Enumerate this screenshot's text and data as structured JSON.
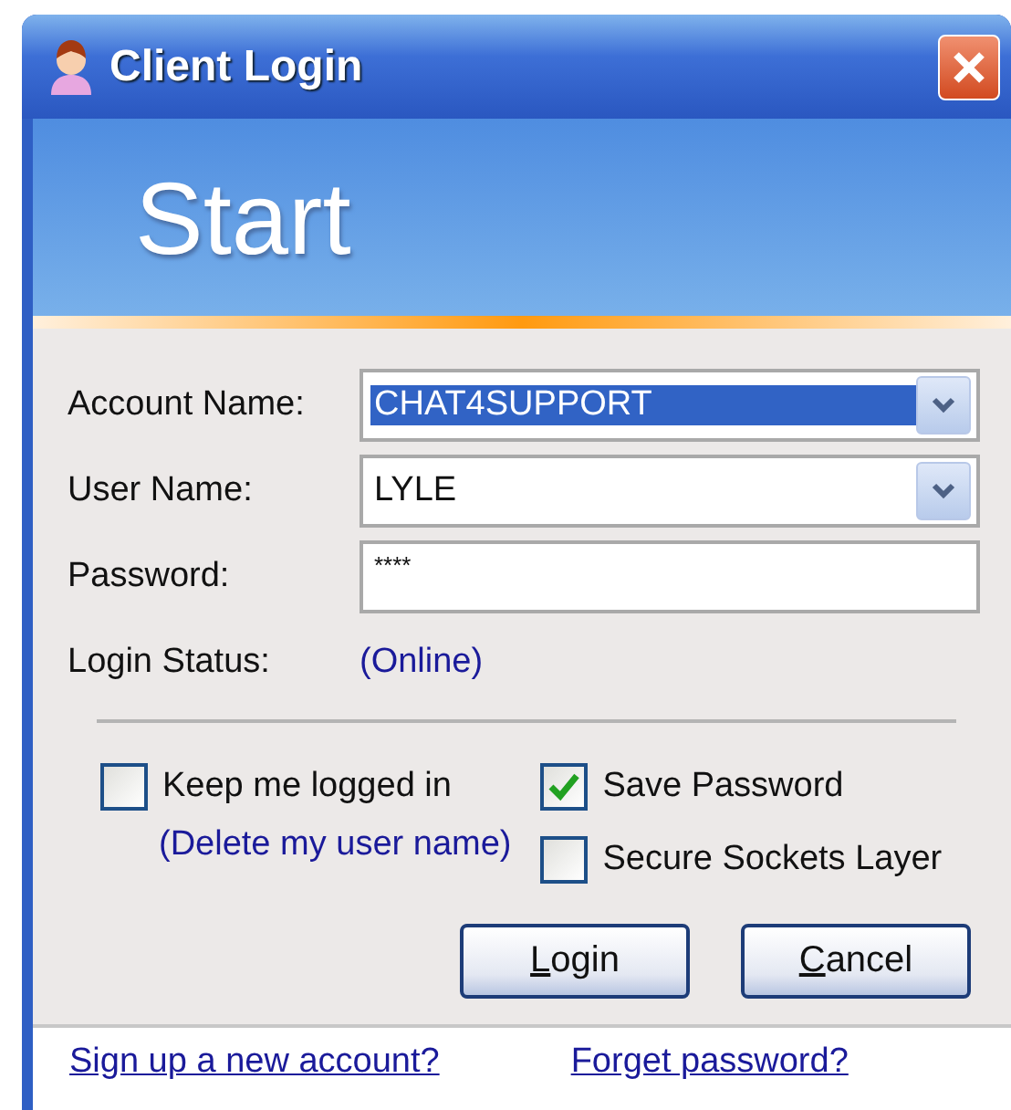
{
  "window": {
    "title": "Client Login"
  },
  "banner": {
    "heading": "Start"
  },
  "form": {
    "fields": [
      {
        "kind": "combo",
        "label": "Account Name:",
        "value": "CHAT4SUPPORT",
        "selected": true
      },
      {
        "kind": "combo",
        "label": "User Name:",
        "value": "LYLE",
        "selected": false
      },
      {
        "kind": "text",
        "label": "Password:",
        "value": "****",
        "selected": false
      }
    ],
    "status": {
      "label": "Login Status:",
      "value": "(Online)"
    }
  },
  "options": {
    "keep_logged_in": {
      "label": "Keep me logged in",
      "checked": false
    },
    "delete_link": "(Delete my user name)",
    "save_password": {
      "label": "Save Password",
      "checked": true
    },
    "ssl": {
      "label": "Secure Sockets Layer",
      "checked": false
    }
  },
  "buttons": [
    "Login",
    "Cancel"
  ],
  "footer": {
    "links": [
      "Sign up a new account?",
      "Forget password?"
    ]
  }
}
